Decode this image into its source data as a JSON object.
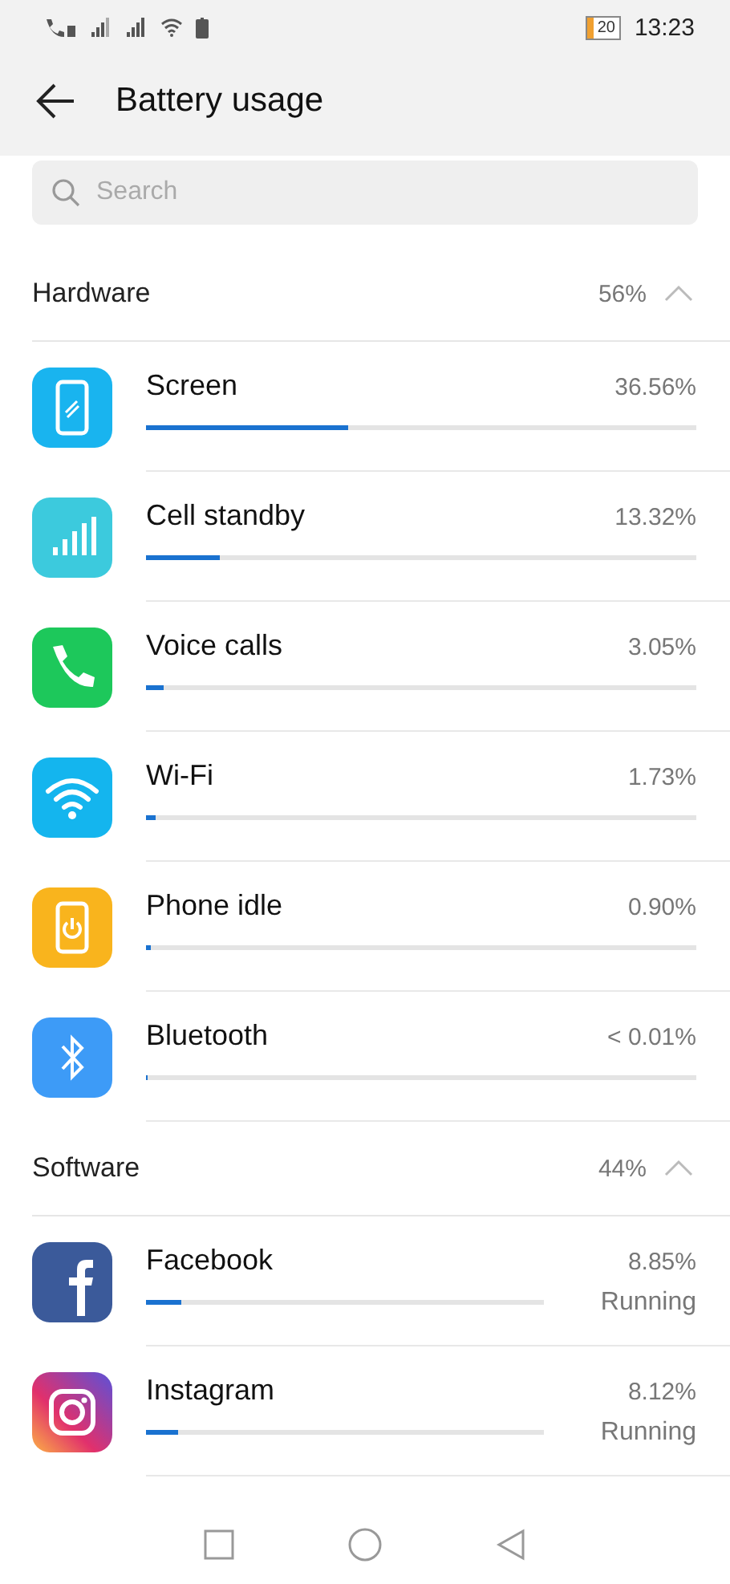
{
  "status_bar": {
    "battery": "20",
    "time": "13:23"
  },
  "header": {
    "title": "Battery usage"
  },
  "search": {
    "placeholder": "Search"
  },
  "sections": [
    {
      "title": "Hardware",
      "share": "56%",
      "expanded": true,
      "items": [
        {
          "kind": "screen",
          "name": "Screen",
          "percent": "36.56%",
          "level": 0.367
        },
        {
          "kind": "signal",
          "name": "Cell standby",
          "percent": "13.32%",
          "level": 0.134
        },
        {
          "kind": "phone",
          "name": "Voice calls",
          "percent": "3.05%",
          "level": 0.031
        },
        {
          "kind": "wifi",
          "name": "Wi-Fi",
          "percent": "1.73%",
          "level": 0.017
        },
        {
          "kind": "power",
          "name": "Phone idle",
          "percent": "0.90%",
          "level": 0.009
        },
        {
          "kind": "bluetooth",
          "name": "Bluetooth",
          "percent": "< 0.01%",
          "level": 0.003
        }
      ]
    },
    {
      "title": "Software",
      "share": "44%",
      "expanded": true,
      "items": [
        {
          "kind": "facebook",
          "name": "Facebook",
          "percent": "8.85%",
          "status": "Running",
          "level": 0.089
        },
        {
          "kind": "instagram",
          "name": "Instagram",
          "percent": "8.12%",
          "status": "Running",
          "level": 0.081
        }
      ]
    }
  ]
}
